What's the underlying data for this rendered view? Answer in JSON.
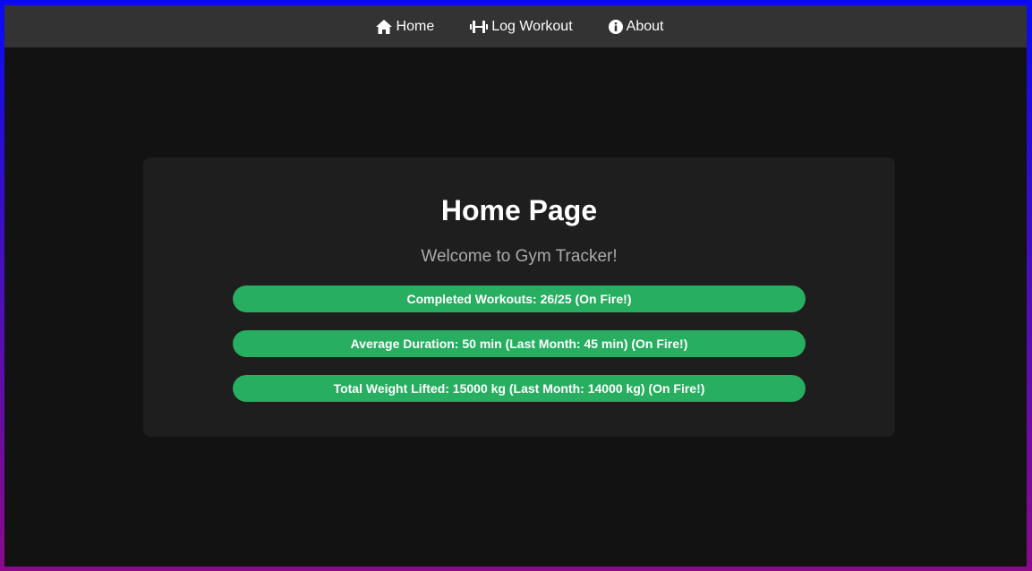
{
  "nav": {
    "items": [
      {
        "label": "Home",
        "icon": "home-icon"
      },
      {
        "label": "Log Workout",
        "icon": "dumbbell-icon"
      },
      {
        "label": "About",
        "icon": "info-icon"
      }
    ]
  },
  "main": {
    "title": "Home Page",
    "subtitle": "Welcome to Gym Tracker!",
    "progress": [
      {
        "label": "Completed Workouts: 26/25 (On Fire!)",
        "fill": 1.0
      },
      {
        "label": "Average Duration: 50 min (Last Month: 45 min) (On Fire!)",
        "fill": 1.0
      },
      {
        "label": "Total Weight Lifted: 15000 kg (Last Month: 14000 kg) (On Fire!)",
        "fill": 1.0
      }
    ]
  },
  "colors": {
    "accent": "#27ae60",
    "navbar": "#333333",
    "background": "#121212",
    "card": "#1e1e1e"
  }
}
